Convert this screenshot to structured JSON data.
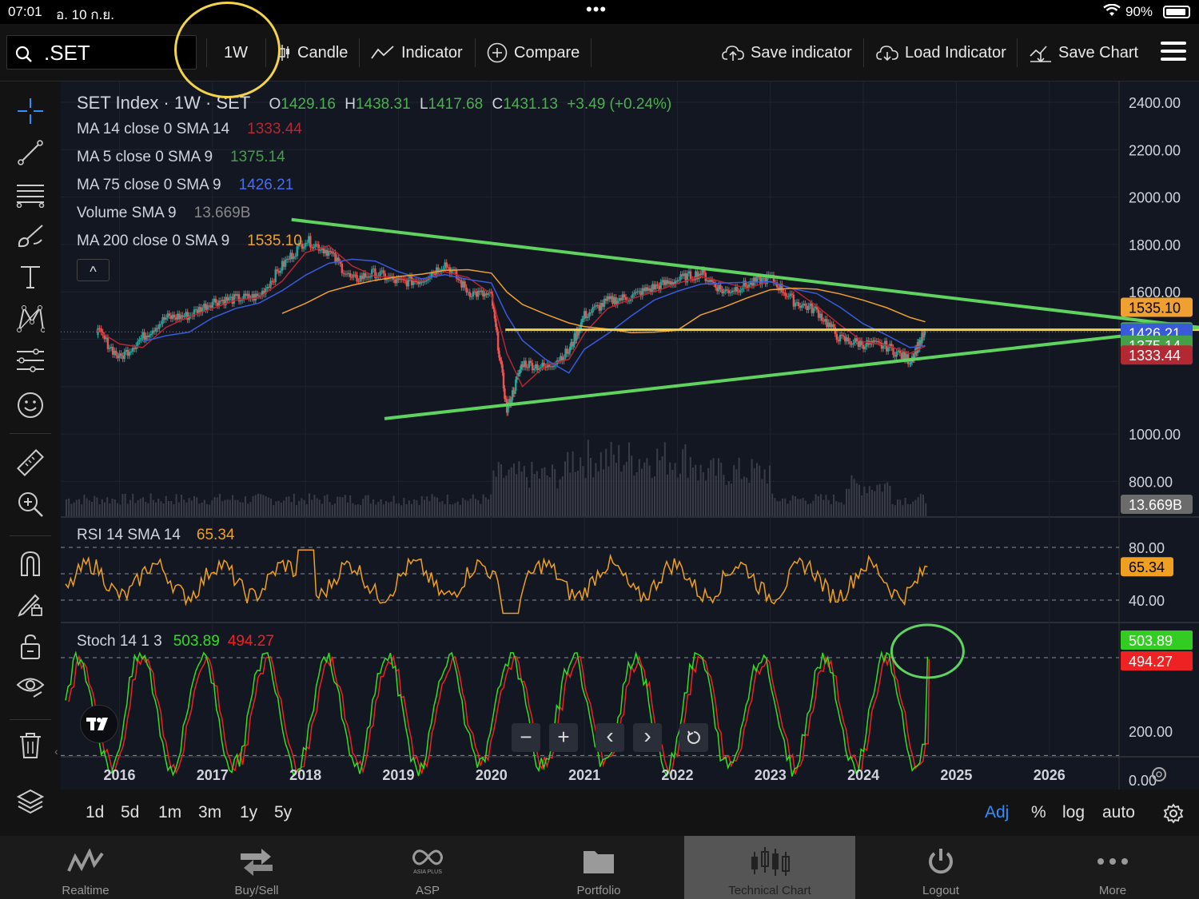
{
  "status_bar": {
    "time": "07:01",
    "date": "อ. 10 ก.ย.",
    "battery": "90%"
  },
  "toolbar": {
    "search_value": ".SET",
    "interval": "1W",
    "chart_type": "Candle",
    "indicator": "Indicator",
    "compare": "Compare",
    "save_indicator": "Save indicator",
    "load_indicator": "Load Indicator",
    "save_chart": "Save Chart"
  },
  "legend": {
    "title": "SET Index · 1W · SET",
    "o_label": "O",
    "o": "1429.16",
    "h_label": "H",
    "h": "1438.31",
    "l_label": "L",
    "l": "1417.68",
    "c_label": "C",
    "c": "1431.13",
    "change": "+3.49 (+0.24%)",
    "ma14_label": "MA 14 close 0 SMA 14",
    "ma14": "1333.44",
    "ma5_label": "MA 5 close 0 SMA 9",
    "ma5": "1375.14",
    "ma75_label": "MA 75 close 0 SMA 9",
    "ma75": "1426.21",
    "vol_label": "Volume SMA 9",
    "vol": "13.669B",
    "ma200_label": "MA 200 close 0 SMA 9",
    "ma200": "1535.10",
    "collapse": "^"
  },
  "rsi": {
    "label": "RSI 14 SMA 14",
    "value": "65.34",
    "ticks": [
      "80.00",
      "40.00"
    ]
  },
  "stoch": {
    "label": "Stoch 14 1 3",
    "k": "503.89",
    "d": "494.27",
    "ticks": [
      "200.00",
      "0.00"
    ]
  },
  "price_axis": {
    "ticks": [
      "2400.00",
      "2200.00",
      "2000.00",
      "1800.00",
      "1600.00",
      "1000.00",
      "800.00"
    ],
    "badges": {
      "ma200": "1535.10",
      "close": "1431.13",
      "ma75": "1426.21",
      "ma5": "1375.14",
      "ma14": "1333.44",
      "volume": "13.669B"
    }
  },
  "time_axis": [
    "2016",
    "2017",
    "2018",
    "2019",
    "2020",
    "2021",
    "2022",
    "2023",
    "2024",
    "2025",
    "2026"
  ],
  "chart_nav": {
    "zoom_out": "−",
    "zoom_in": "+",
    "back": "‹",
    "forward": "›"
  },
  "ranges": [
    "1d",
    "5d",
    "1m",
    "3m",
    "1y",
    "5y"
  ],
  "axis_modes": [
    "Adj",
    "%",
    "log",
    "auto"
  ],
  "bottom_nav": [
    "Realtime",
    "Buy/Sell",
    "ASP",
    "Portfolio",
    "Technical Chart",
    "Logout",
    "More"
  ],
  "asp_logo_text": "ASIA PLUS",
  "colors": {
    "chart_bg": "#131722",
    "ma14": "#b22833",
    "ma5": "#43a047",
    "ma75": "#3a5bd9",
    "ma200": "#f0a030",
    "close_line": "#f2d349",
    "trendline": "#5fd35f",
    "rsi": "#f0a020",
    "stoch_k": "#33dd22",
    "stoch_d": "#ee2222",
    "active_tab": "#555555"
  },
  "chart_data": {
    "type": "line",
    "title": "SET Index · 1W · SET",
    "x": [
      "2015-10",
      "2016-01",
      "2016-04",
      "2016-07",
      "2016-10",
      "2017-01",
      "2017-04",
      "2017-07",
      "2017-10",
      "2018-01",
      "2018-04",
      "2018-07",
      "2018-10",
      "2019-01",
      "2019-04",
      "2019-07",
      "2019-10",
      "2020-01",
      "2020-03",
      "2020-05",
      "2020-08",
      "2020-11",
      "2021-01",
      "2021-04",
      "2021-07",
      "2021-10",
      "2022-01",
      "2022-04",
      "2022-07",
      "2022-10",
      "2023-01",
      "2023-04",
      "2023-07",
      "2023-10",
      "2024-01",
      "2024-04",
      "2024-07",
      "2024-09"
    ],
    "series": [
      {
        "name": "SET Index",
        "values": [
          1440,
          1320,
          1410,
          1490,
          1500,
          1560,
          1570,
          1580,
          1710,
          1820,
          1770,
          1650,
          1680,
          1640,
          1650,
          1720,
          1600,
          1580,
          1100,
          1300,
          1280,
          1350,
          1500,
          1560,
          1580,
          1620,
          1650,
          1680,
          1600,
          1630,
          1660,
          1560,
          1520,
          1400,
          1380,
          1370,
          1310,
          1431
        ]
      }
    ],
    "ylim": [
      700,
      2450
    ],
    "xlim": [
      "2015-06",
      "2026-09"
    ]
  }
}
